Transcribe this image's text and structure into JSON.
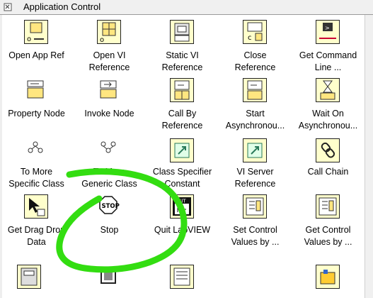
{
  "window": {
    "title": "Application Control"
  },
  "palette": {
    "rows": [
      [
        "Open App Ref",
        "Open VI\nReference",
        "Static VI\nReference",
        "Close\nReference",
        "Get Command\nLine ..."
      ],
      [
        "Property Node",
        "Invoke Node",
        "Call By\nReference",
        "Start\nAsynchronou...",
        "Wait On\nAsynchronou..."
      ],
      [
        "To More\nSpecific Class",
        "To More\nGeneric Class",
        "Class Specifier\nConstant",
        "VI Server\nReference",
        "Call Chain"
      ],
      [
        "Get Drag Drop\nData",
        "Stop",
        "Quit LabVIEW",
        "Set Control\nValues by ...",
        "Get Control\nValues by ..."
      ]
    ],
    "partial_row_labels": [
      "...",
      "...",
      "...",
      "",
      "..."
    ]
  },
  "colors": {
    "icon_bg": "#ffffcc",
    "annotation": "#33dd11",
    "titlebar": "#f0f0f0"
  }
}
